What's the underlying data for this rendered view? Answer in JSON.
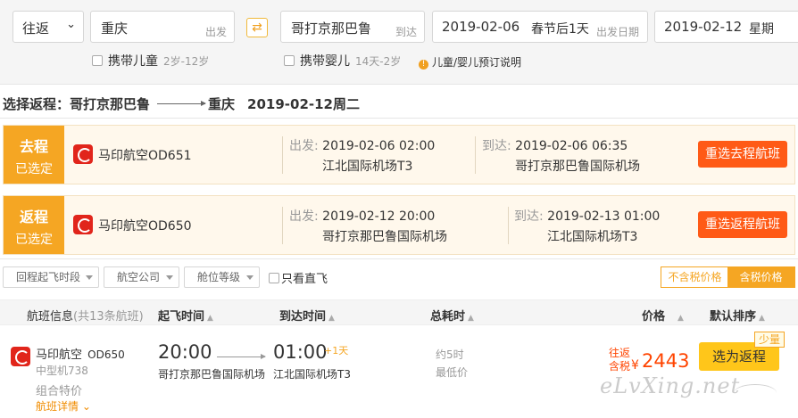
{
  "search": {
    "trip_type": "往返",
    "from_city": "重庆",
    "from_tag": "出发",
    "to_city": "哥打京那巴鲁",
    "to_tag": "到达",
    "swap_icon": "⇄",
    "depart_date": "2019-02-06",
    "depart_holiday": "春节后1天",
    "depart_label": "出发日期",
    "return_date": "2019-02-12",
    "return_weekday": "星期"
  },
  "options": {
    "child_label": "携带儿童",
    "child_age": "2岁-12岁",
    "infant_label": "携带婴儿",
    "infant_age": "14天-2岁",
    "booking_note": "儿童/婴儿预订说明"
  },
  "heading": {
    "prefix": "选择返程：",
    "from": "哥打京那巴鲁",
    "to": "重庆",
    "date": "2019-02-12周二"
  },
  "outbound": {
    "badge_title": "去程",
    "badge_sub": "已选定",
    "airline": "马印航空OD651",
    "dep_label": "出发:",
    "dep_time": "2019-02-06 02:00",
    "dep_airport": "江北国际机场T3",
    "arr_label": "到达:",
    "arr_time": "2019-02-06 06:35",
    "arr_airport": "哥打京那巴鲁国际机场",
    "button": "重选去程航班"
  },
  "return": {
    "badge_title": "返程",
    "badge_sub": "已选定",
    "airline": "马印航空OD650",
    "dep_label": "出发:",
    "dep_time": "2019-02-12 20:00",
    "dep_airport": "哥打京那巴鲁国际机场",
    "arr_label": "到达:",
    "arr_time": "2019-02-13 01:00",
    "arr_airport": "江北国际机场T3",
    "button": "重选返程航班"
  },
  "filters": {
    "dep_period": "回程起飞时段",
    "airline": "航空公司",
    "cabin": "舱位等级",
    "direct_only": "只看直飞",
    "price_excl_tax": "不含税价格",
    "price_incl_tax": "含税价格"
  },
  "columns": {
    "info": "航班信息",
    "count": "(共13条航班)",
    "dep_time": "起飞时间",
    "arr_time": "到达时间",
    "duration": "总耗时",
    "price": "价格",
    "default_sort": "默认排序",
    "sort_icon": "▲"
  },
  "flight": {
    "airline": "马印航空",
    "flight_no": "OD650",
    "aircraft": "中型机738",
    "combo": "组合特价",
    "detail_link": "航班详情",
    "detail_chevron": "⌄",
    "dep_time": "20:00",
    "dep_airport": "哥打京那巴鲁国际机场",
    "arr_time": "01:00",
    "arr_day": "+1天",
    "arr_airport": "江北国际机场T3",
    "duration": "约5时",
    "duration_note": "最低价",
    "price_label_1": "往返",
    "price_label_2": "含税",
    "currency": "¥",
    "price": "2443",
    "select_button": "选为返程",
    "seats_badge": "少量"
  },
  "watermark": "eLvXing.net",
  "colors": {
    "accent_orange": "#f5a623",
    "button_red": "#ff5a16",
    "price_red": "#ff4400",
    "select_yellow": "#ffc61a"
  }
}
